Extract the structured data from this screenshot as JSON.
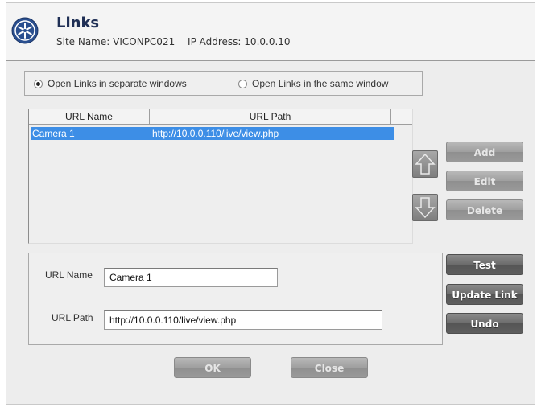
{
  "header": {
    "title": "Links",
    "site_name_label": "Site Name:",
    "site_name": "VICONPC021",
    "ip_label": "IP Address:",
    "ip_address": "10.0.0.10"
  },
  "options": {
    "separate_windows": "Open Links in separate windows",
    "same_window": "Open Links in the same window",
    "selected": "separate_windows"
  },
  "list": {
    "columns": [
      "URL Name",
      "URL Path"
    ],
    "rows": [
      {
        "name": "Camera 1",
        "path": "http://10.0.0.110/live/view.php",
        "selected": true
      }
    ]
  },
  "buttons": {
    "add": "Add",
    "edit": "Edit",
    "delete": "Delete",
    "test": "Test",
    "update_link": "Update Link",
    "undo": "Undo",
    "ok": "OK",
    "close": "Close"
  },
  "form": {
    "url_name_label": "URL Name",
    "url_name_value": "Camera 1",
    "url_path_label": "URL Path",
    "url_path_value": "http://10.0.0.110/live/view.php"
  },
  "icons": {
    "logo": "snowflake-logo-icon",
    "move_up": "arrow-up-icon",
    "move_down": "arrow-down-icon"
  },
  "colors": {
    "selection": "#3d8ee6",
    "title": "#1f2f55"
  }
}
